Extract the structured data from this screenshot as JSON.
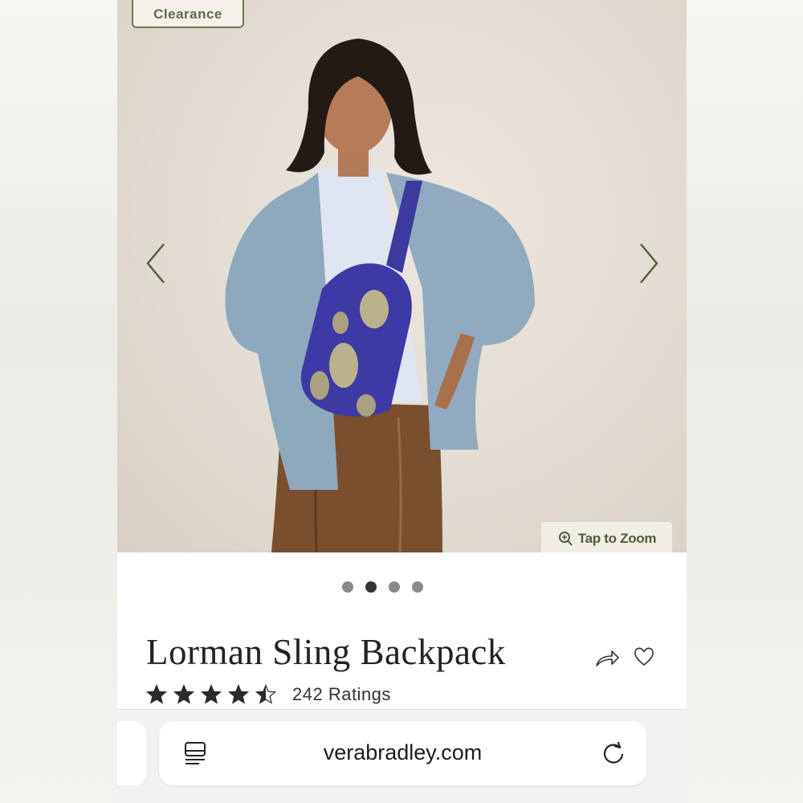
{
  "product_image": {
    "badge_label": "Clearance",
    "zoom_label": "Tap to Zoom",
    "carousel": {
      "total": 4,
      "active_index": 1
    }
  },
  "product": {
    "title": "Lorman Sling Backpack",
    "rating": 4.5,
    "rating_count_label": "242 Ratings"
  },
  "browser": {
    "url": "verabradley.com"
  },
  "colors": {
    "accent": "#5c6b43",
    "star": "#2b2b2b"
  },
  "icons": [
    "chevron-left-icon",
    "chevron-right-icon",
    "zoom-icon",
    "share-icon",
    "heart-icon",
    "star-icon",
    "reader-icon",
    "reload-icon"
  ]
}
